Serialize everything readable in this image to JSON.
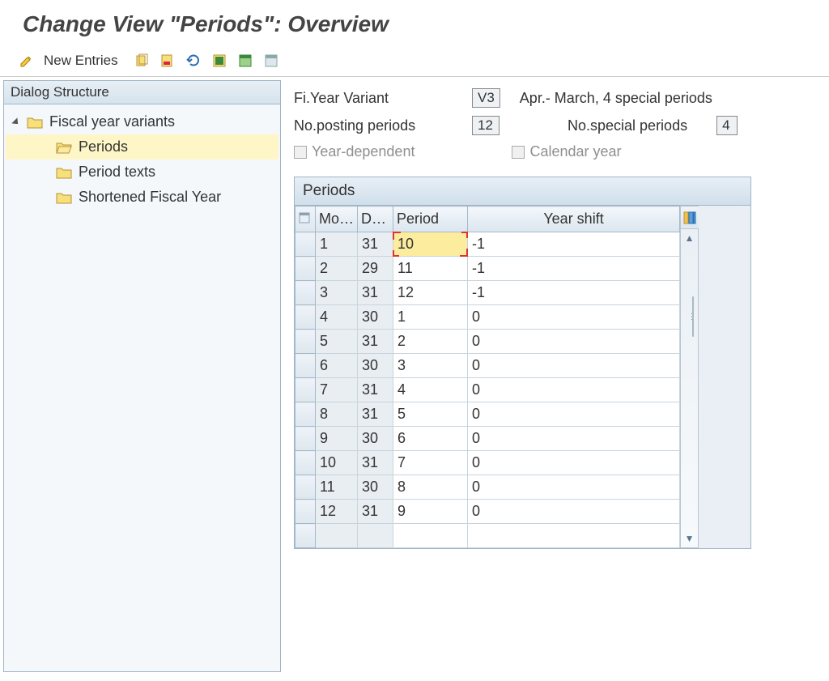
{
  "title": "Change View \"Periods\": Overview",
  "toolbar": {
    "new_entries_label": "New Entries"
  },
  "sidebar": {
    "title": "Dialog Structure",
    "root": "Fiscal year variants",
    "items": [
      "Periods",
      "Period texts",
      "Shortened Fiscal Year"
    ],
    "selected_index": 0
  },
  "meta": {
    "fi_year_variant_label": "Fi.Year Variant",
    "fi_year_variant_value": "V3",
    "fi_year_variant_desc": "Apr.- March, 4 special periods",
    "no_posting_label": "No.posting periods",
    "no_posting_value": "12",
    "no_special_label": "No.special periods",
    "no_special_value": "4",
    "year_dep_label": "Year-dependent",
    "cal_year_label": "Calendar year"
  },
  "table": {
    "title": "Periods",
    "columns": [
      "Mo…",
      "D…",
      "Period",
      "Year shift"
    ],
    "rows": [
      {
        "mo": "1",
        "day": "31",
        "period": "10",
        "shift": "-1"
      },
      {
        "mo": "2",
        "day": "29",
        "period": "11",
        "shift": "-1"
      },
      {
        "mo": "3",
        "day": "31",
        "period": "12",
        "shift": "-1"
      },
      {
        "mo": "4",
        "day": "30",
        "period": "1",
        "shift": "0"
      },
      {
        "mo": "5",
        "day": "31",
        "period": "2",
        "shift": "0"
      },
      {
        "mo": "6",
        "day": "30",
        "period": "3",
        "shift": "0"
      },
      {
        "mo": "7",
        "day": "31",
        "period": "4",
        "shift": "0"
      },
      {
        "mo": "8",
        "day": "31",
        "period": "5",
        "shift": "0"
      },
      {
        "mo": "9",
        "day": "30",
        "period": "6",
        "shift": "0"
      },
      {
        "mo": "10",
        "day": "31",
        "period": "7",
        "shift": "0"
      },
      {
        "mo": "11",
        "day": "30",
        "period": "8",
        "shift": "0"
      },
      {
        "mo": "12",
        "day": "31",
        "period": "9",
        "shift": "0"
      }
    ],
    "highlighted_row": 0
  }
}
